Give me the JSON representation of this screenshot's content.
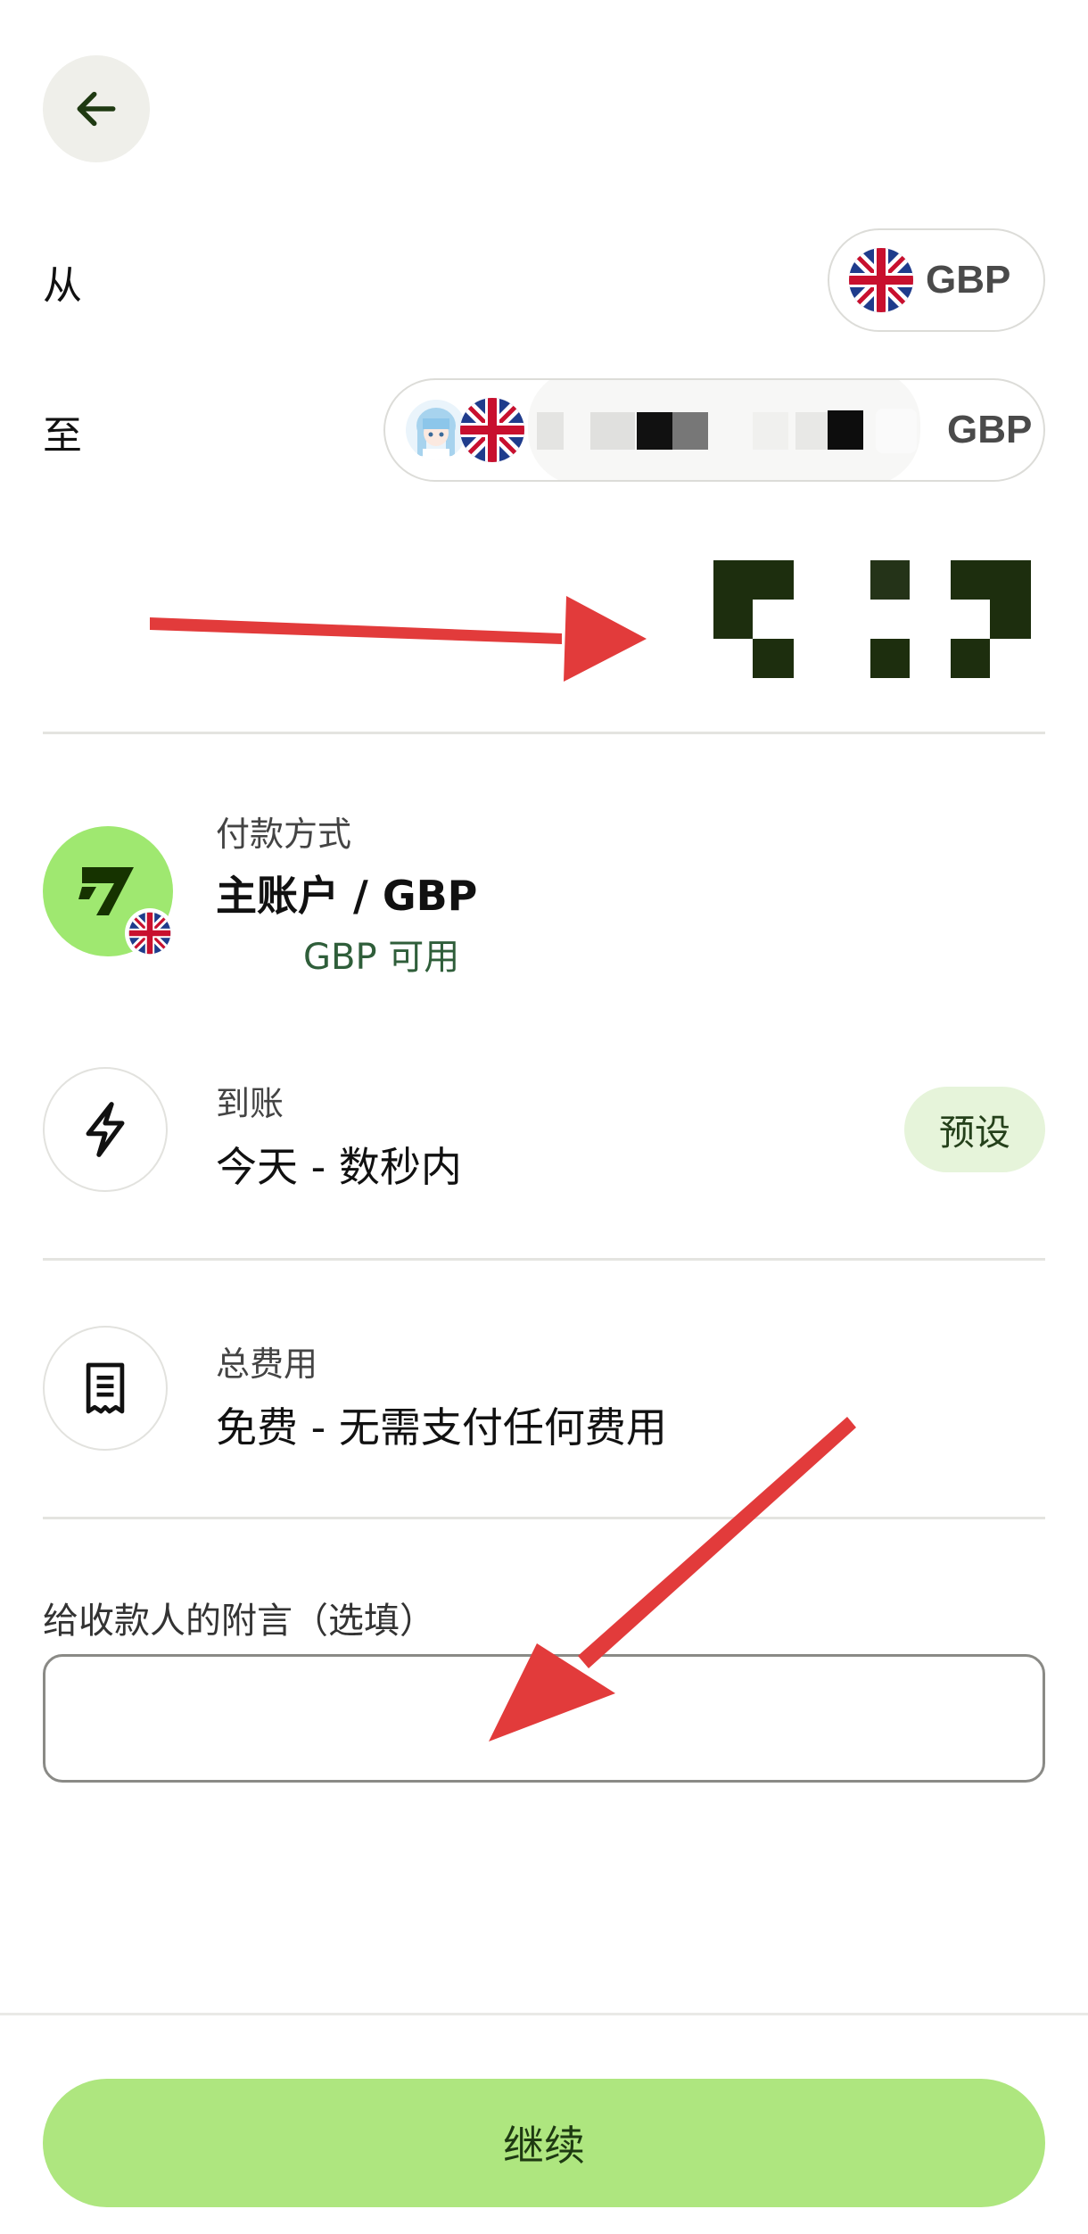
{
  "nav": {
    "back_icon": "arrow-left-icon"
  },
  "from": {
    "label": "从",
    "currency": "GBP",
    "flag_icon": "uk-flag-icon"
  },
  "to": {
    "label": "至",
    "currency": "GBP",
    "avatar_icon": "anime-avatar-icon",
    "flag_icon": "uk-flag-icon"
  },
  "payment": {
    "label": "付款方式",
    "account": "主账户 / GBP",
    "available": "GBP 可用",
    "icon": "wise-logo-icon"
  },
  "arrival": {
    "label": "到账",
    "value": "今天 - 数秒内",
    "badge": "预设",
    "icon": "lightning-icon"
  },
  "fees": {
    "label": "总费用",
    "value": "免费 - 无需支付任何费用",
    "icon": "receipt-icon"
  },
  "note": {
    "label": "给收款人的附言（选填）",
    "value": ""
  },
  "actions": {
    "continue_label": "继续"
  },
  "colors": {
    "accent_green": "#aee67f",
    "badge_bg": "#e6f4da",
    "annotation_red": "#e23b3b",
    "redacted_dark": "#1d2e0e"
  }
}
